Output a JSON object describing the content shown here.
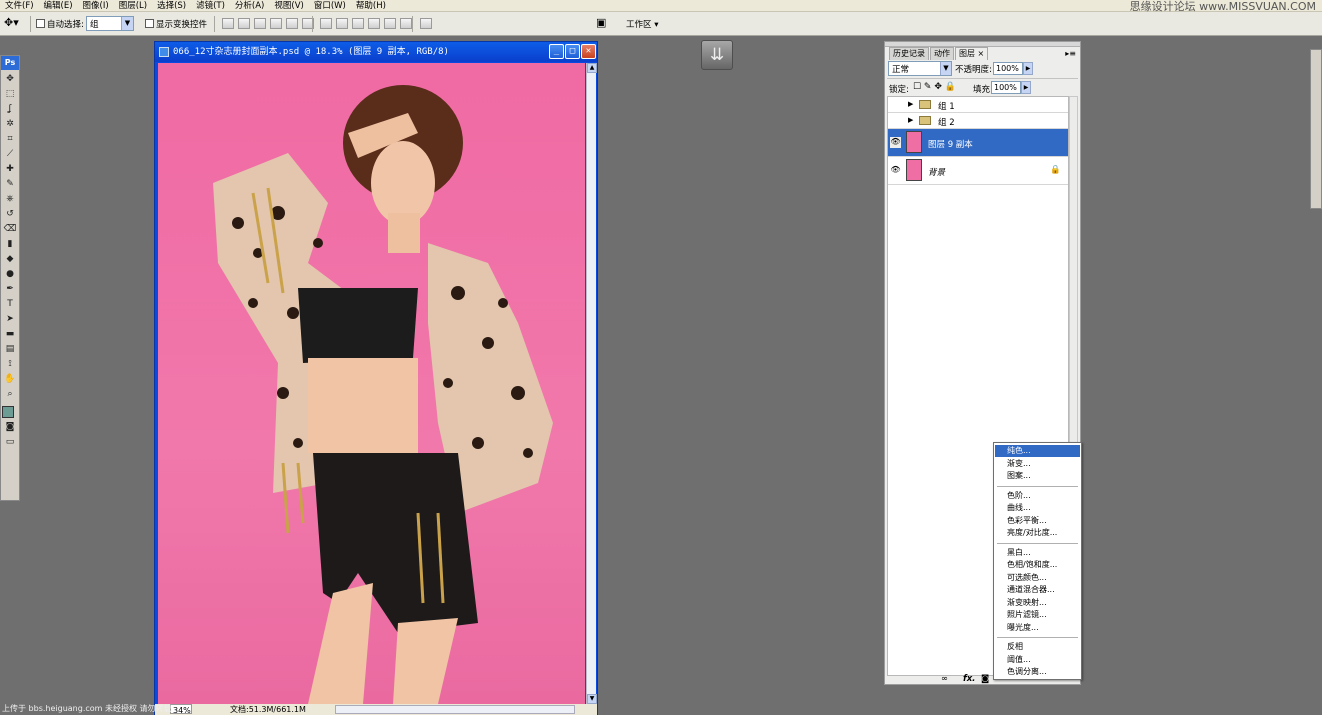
{
  "menubar": {
    "items": [
      "文件(F)",
      "编辑(E)",
      "图像(I)",
      "图层(L)",
      "选择(S)",
      "滤镜(T)",
      "分析(A)",
      "视图(V)",
      "窗口(W)",
      "帮助(H)"
    ],
    "watermark": "思缘设计论坛  www.MISSVUAN.COM"
  },
  "options": {
    "auto_select_label": "自动选择:",
    "auto_select_value": "组",
    "show_transform_label": "显示变换控件",
    "workspace_label": "工作区",
    "auto_select_checked": false,
    "show_transform_checked": false
  },
  "toolbox": {
    "logo": "Ps",
    "tools": [
      "move-icon",
      "marquee-icon",
      "lasso-icon",
      "magic-wand-icon",
      "crop-icon",
      "slice-icon",
      "healing-brush-icon",
      "brush-icon",
      "clone-stamp-icon",
      "history-brush-icon",
      "eraser-icon",
      "gradient-icon",
      "blur-icon",
      "dodge-icon",
      "pen-icon",
      "type-icon",
      "path-selection-icon",
      "shape-icon",
      "notes-icon",
      "eyedropper-icon",
      "hand-icon",
      "zoom-icon"
    ],
    "foreground_color": "#6c9c93"
  },
  "document": {
    "title": "066_12寸杂志册封面副本.psd @ 18.3% (图层 9 副本, RGB/8)",
    "zoom": "34%",
    "doc_size": "文档:51.3M/661.1M"
  },
  "watermark_bottom": "上传于 bbs.heiguang.com  未经授权  请勿转载",
  "layers_panel": {
    "tabs": [
      "历史记录",
      "动作",
      "图层"
    ],
    "active_tab": 2,
    "blend_mode": "正常",
    "opacity_label": "不透明度:",
    "opacity_value": "100%",
    "lock_label": "锁定:",
    "fill_label": "填充:",
    "fill_value": "100%",
    "layers": [
      {
        "name": "组 1",
        "type": "group",
        "visible": false
      },
      {
        "name": "组 2",
        "type": "group",
        "visible": false
      },
      {
        "name": "图层 9 副本",
        "type": "layer",
        "visible": true,
        "selected": true
      },
      {
        "name": "背景",
        "type": "background",
        "visible": true,
        "locked": true
      }
    ],
    "footer_icons": [
      "link-icon",
      "fx-icon",
      "mask-icon",
      "adjustment-icon",
      "group-icon",
      "new-layer-icon",
      "trash-icon"
    ]
  },
  "adjustment_menu": {
    "groups": [
      [
        "纯色...",
        "渐变...",
        "图案..."
      ],
      [
        "色阶...",
        "曲线...",
        "色彩平衡...",
        "亮度/对比度..."
      ],
      [
        "黑白...",
        "色相/饱和度...",
        "可选颜色...",
        "通道混合器...",
        "渐变映射...",
        "照片滤镜...",
        "曝光度..."
      ],
      [
        "反相",
        "阈值...",
        "色调分离..."
      ]
    ],
    "highlighted": "纯色..."
  },
  "colors": {
    "accent": "#316ac5",
    "title_bar": "#0a4ae0",
    "canvas_pink": "#f06aa3",
    "workspace": "#6f6f6f"
  }
}
